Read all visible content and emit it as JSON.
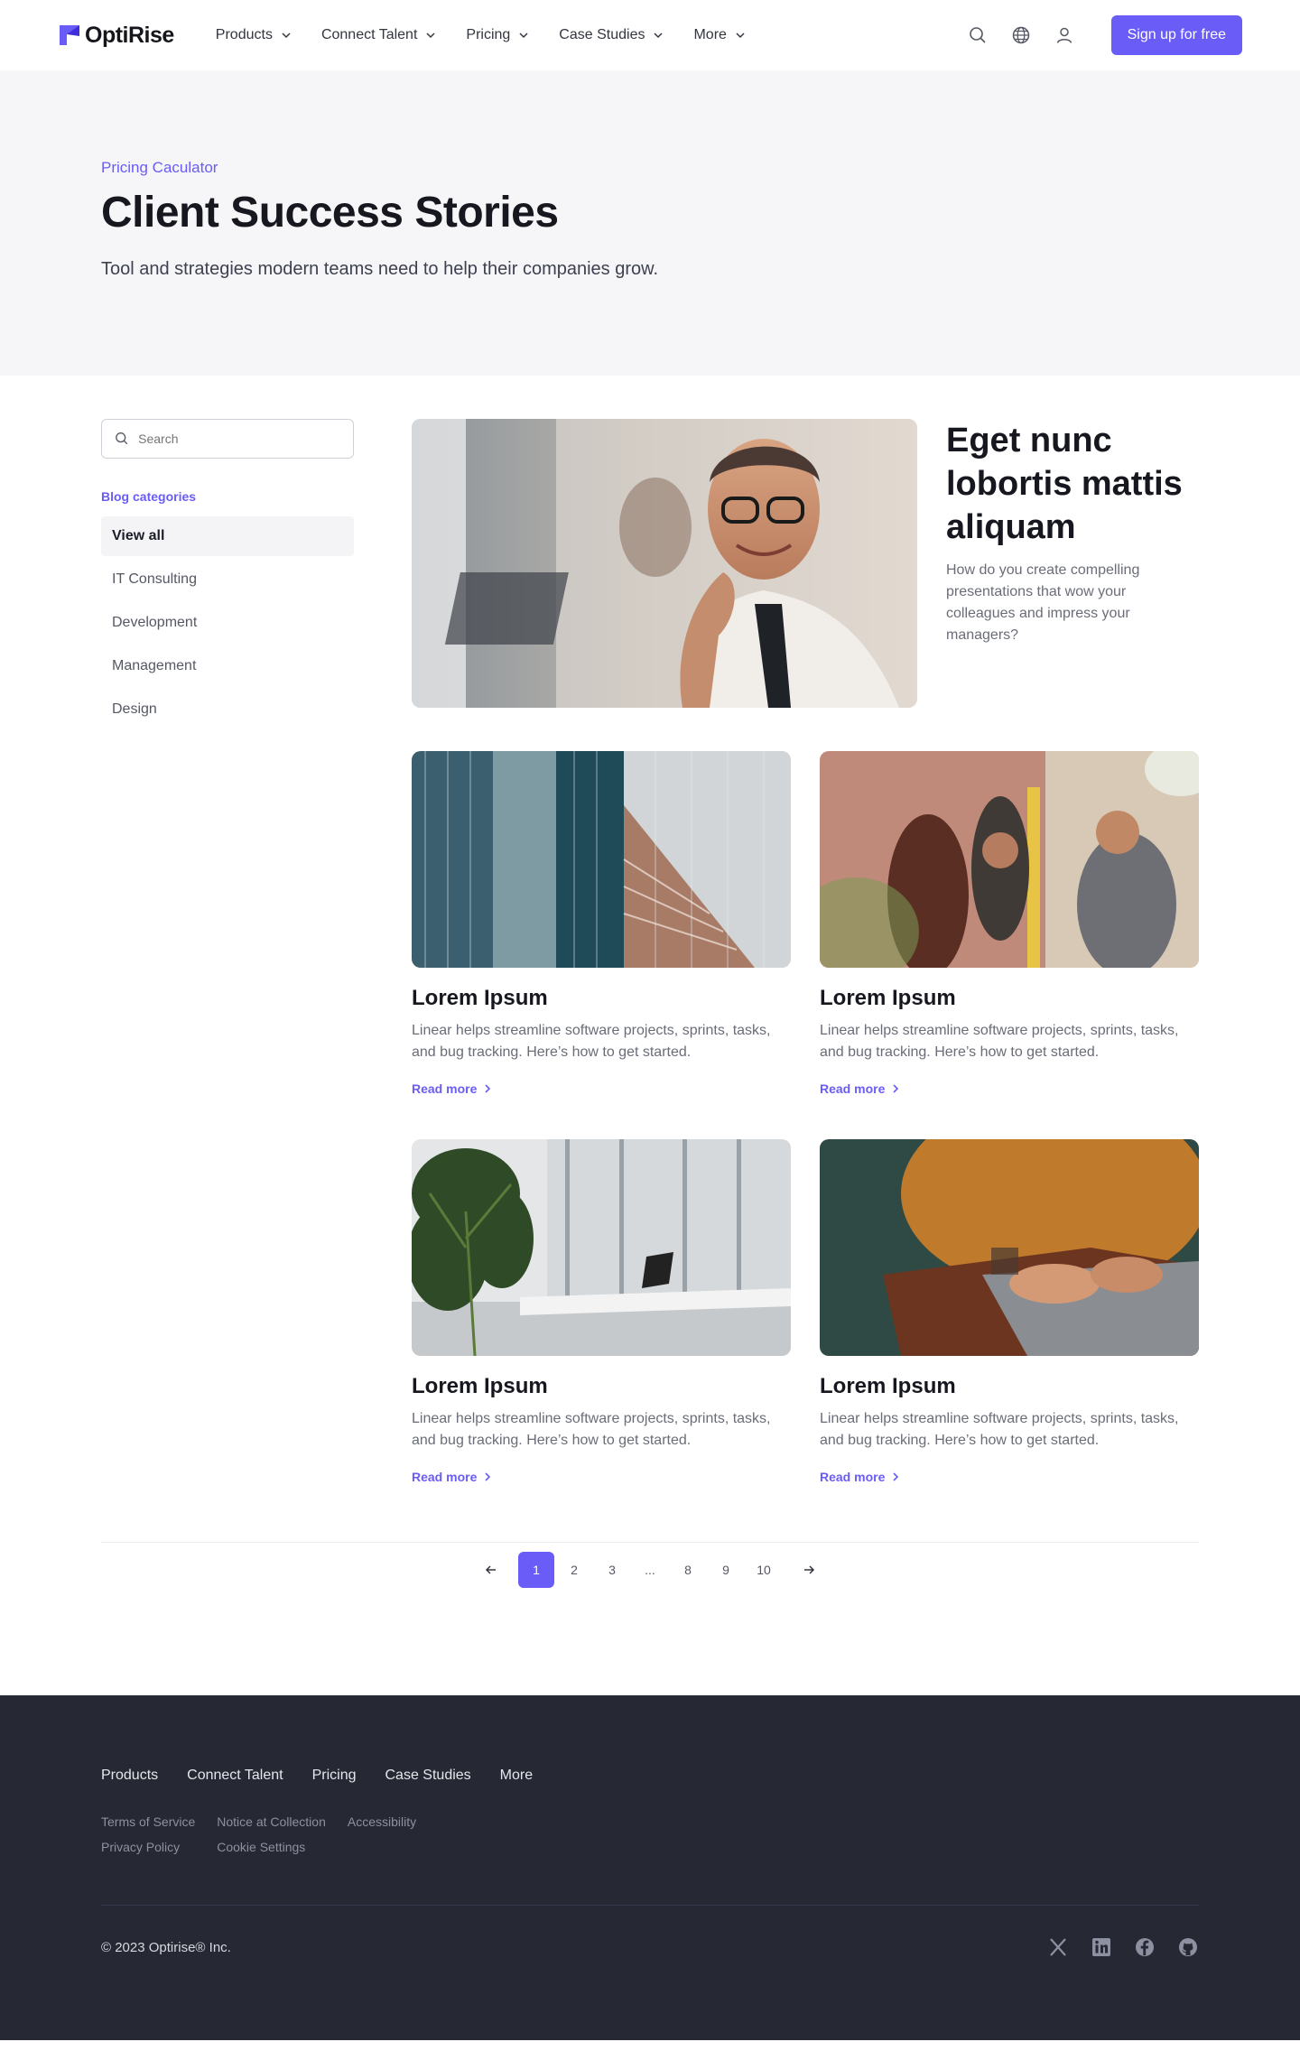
{
  "nav": {
    "logo": "OptiRise",
    "menu": [
      {
        "label": "Products"
      },
      {
        "label": "Connect Talent"
      },
      {
        "label": "Pricing"
      },
      {
        "label": "Case Studies"
      },
      {
        "label": "More"
      }
    ],
    "signup": "Sign up for free",
    "icons": [
      "search-icon",
      "globe-icon",
      "user-icon",
      "chevron-down-icon"
    ]
  },
  "hero": {
    "eyebrow": "Pricing Caculator",
    "title": "Client Success Stories",
    "subtitle": "Tool and strategies modern teams need to help their companies grow."
  },
  "sidebar": {
    "search_placeholder": "Search",
    "categories_title": "Blog categories",
    "categories": [
      {
        "label": "View all",
        "active": true
      },
      {
        "label": "IT Consulting"
      },
      {
        "label": "Development"
      },
      {
        "label": "Management"
      },
      {
        "label": "Design"
      }
    ]
  },
  "featured": {
    "title": "Eget nunc lobortis mattis aliquam",
    "text": "How do you create compelling presentations that wow your colleagues and impress your managers?"
  },
  "cards": [
    {
      "title": "Lorem Ipsum",
      "text": "Linear helps streamline software projects, sprints, tasks, and bug tracking. Here’s how to get started.",
      "link": "Read more"
    },
    {
      "title": "Lorem Ipsum",
      "text": "Linear helps streamline software projects, sprints, tasks, and bug tracking. Here’s how to get started.",
      "link": "Read more"
    },
    {
      "title": "Lorem Ipsum",
      "text": "Linear helps streamline software projects, sprints, tasks, and bug tracking. Here’s how to get started.",
      "link": "Read more"
    },
    {
      "title": "Lorem Ipsum",
      "text": "Linear helps streamline software projects, sprints, tasks, and bug tracking. Here’s how to get started.",
      "link": "Read more"
    }
  ],
  "pagination": {
    "pages": [
      "1",
      "2",
      "3",
      "...",
      "8",
      "9",
      "10"
    ],
    "current": "1"
  },
  "footer": {
    "links": [
      "Products",
      "Connect Talent",
      "Pricing",
      "Case Studies",
      "More"
    ],
    "legal": [
      "Terms of Service",
      "Notice at Collection",
      "Accessibility",
      "Privacy Policy",
      "Cookie Settings"
    ],
    "copyright": "© 2023 Optirise® Inc.",
    "social": [
      "x-icon",
      "linkedin-icon",
      "facebook-icon",
      "github-icon"
    ]
  },
  "colors": {
    "accent": "#6a5cf6",
    "footer_bg": "#262833",
    "hero_bg": "#f6f6f8"
  }
}
